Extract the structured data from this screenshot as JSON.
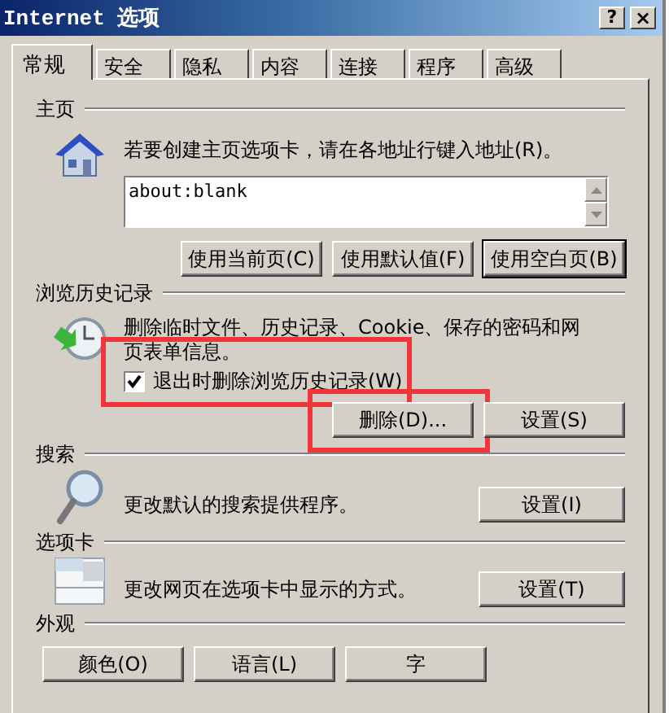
{
  "window": {
    "title": "Internet 选项",
    "controls": [
      {
        "kind": "help",
        "label": "?"
      },
      {
        "kind": "close",
        "label": "×"
      }
    ]
  },
  "tabs": [
    {
      "label": "常规",
      "selected": true
    },
    {
      "label": "安全",
      "selected": false
    },
    {
      "label": "隐私",
      "selected": false
    },
    {
      "label": "内容",
      "selected": false
    },
    {
      "label": "连接",
      "selected": false
    },
    {
      "label": "程序",
      "selected": false
    },
    {
      "label": "高级",
      "selected": false
    }
  ],
  "home_page": {
    "heading": "主页",
    "description": "若要创建主页选项卡，请在各地址行键入地址(R)。",
    "value": "about:blank",
    "buttons": [
      {
        "label": "使用当前页(C)",
        "default": false
      },
      {
        "label": "使用默认值(F)",
        "default": false
      },
      {
        "label": "使用空白页(B)",
        "default": true
      }
    ]
  },
  "browsing_history": {
    "heading": "浏览历史记录",
    "description": "删除临时文件、历史记录、Cookie、保存的密码和网页表单信息。",
    "delete_on_exit": {
      "label": "退出时删除浏览历史记录(W)",
      "checked": true,
      "highlighted": true
    },
    "buttons": [
      {
        "label": "删除(D)...",
        "highlighted": true
      },
      {
        "label": "设置(S)",
        "highlighted": false
      }
    ]
  },
  "search": {
    "heading": "搜索",
    "description": "更改默认的搜索提供程序。",
    "button": "设置(I)"
  },
  "tab_settings": {
    "heading": "选项卡",
    "description": "更改网页在选项卡中显示的方式。",
    "button": "设置(T)"
  },
  "appearance": {
    "heading": "外观",
    "buttons": [
      "颜色(O)",
      "语言(L)",
      "字"
    ]
  }
}
